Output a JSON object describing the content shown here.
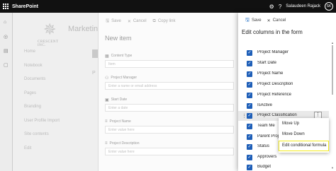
{
  "topbar": {
    "app_name": "SharePoint",
    "user_name": "Salaudeen Rajack",
    "user_initials": "SK",
    "icons": [
      "waffle-icon",
      "settings-icon",
      "help-icon"
    ]
  },
  "site": {
    "logo_text": "CRESCENT INC.",
    "title": "Marketin",
    "nav": [
      "Home",
      "Notebook",
      "Documents",
      "Pages",
      "Branding",
      "User Profile Import",
      "Site contents",
      "Edit"
    ],
    "partial_letter": "P"
  },
  "new_item": {
    "toolbar": {
      "save": "Save",
      "cancel": "Cancel",
      "copy_link": "Copy link"
    },
    "title": "New item",
    "fields": [
      {
        "label": "Content Type",
        "value": "Item",
        "icon": "content-type-icon"
      },
      {
        "label": "Project Manager",
        "value": "Enter a name or email address",
        "icon": "person-icon"
      },
      {
        "label": "Start Date",
        "value": "Enter a date",
        "icon": "calendar-icon"
      },
      {
        "label": "Project Name",
        "value": "Enter value here",
        "icon": "text-icon"
      },
      {
        "label": "Project Description",
        "value": "Enter value here",
        "icon": "text-icon"
      }
    ]
  },
  "edit_columns": {
    "toolbar": {
      "save": "Save",
      "cancel": "Cancel"
    },
    "title": "Edit columns in the form",
    "columns": [
      {
        "label": "Project Manager",
        "checked": true
      },
      {
        "label": "Start Date",
        "checked": true
      },
      {
        "label": "Project Name",
        "checked": true
      },
      {
        "label": "Project Description",
        "checked": true
      },
      {
        "label": "Project Reference",
        "checked": true
      },
      {
        "label": "IsActive",
        "checked": true
      },
      {
        "label": "Project Classification",
        "checked": true,
        "selected": true
      },
      {
        "label": "Team Memb",
        "checked": true
      },
      {
        "label": "Parent Proj",
        "checked": true
      },
      {
        "label": "Status",
        "checked": true
      },
      {
        "label": "Approvers",
        "checked": true
      },
      {
        "label": "Budget",
        "checked": true
      }
    ],
    "more_label": "⋮"
  },
  "context_menu": {
    "items": [
      "Move Up",
      "Move Down",
      "Edit conditional formula"
    ],
    "highlighted_index": 2,
    "highlight_color": "#f2ea1c"
  },
  "colors": {
    "accent": "#1f5fb8",
    "topbar": "#111111"
  }
}
